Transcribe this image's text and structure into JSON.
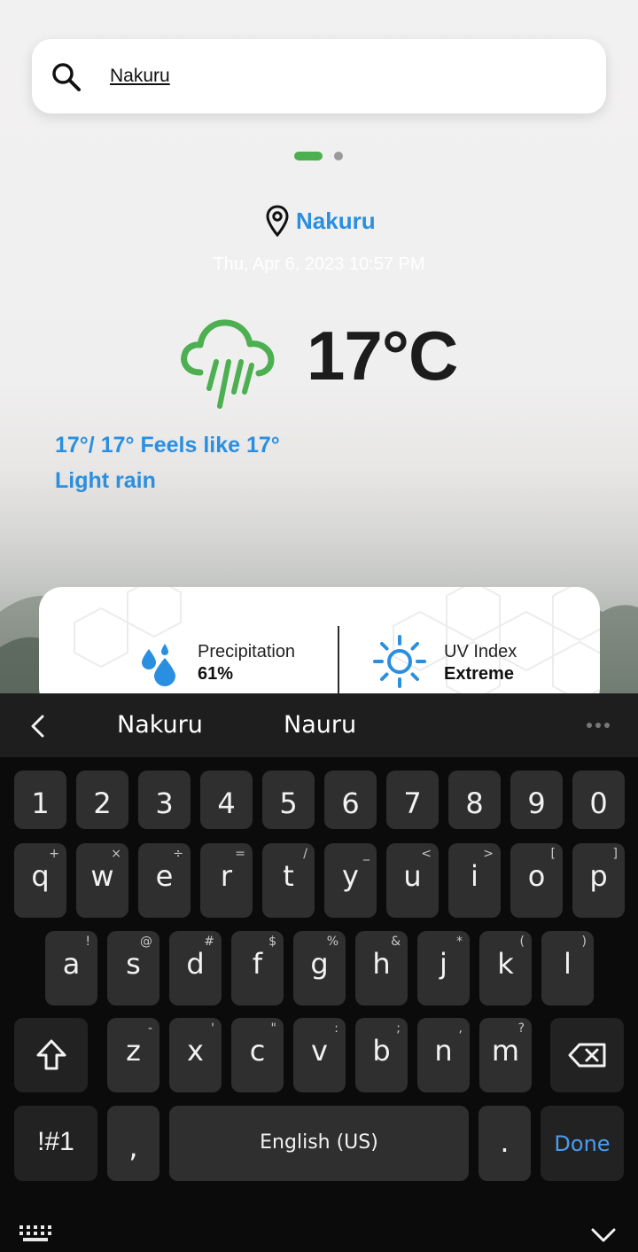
{
  "search": {
    "value": "Nakuru",
    "icon": "search-icon"
  },
  "location": {
    "name": "Nakuru",
    "icon": "location-pin-icon"
  },
  "datetime": "Thu, Apr 6, 2023 10:57 PM",
  "weather": {
    "icon": "rain-cloud-icon",
    "temperature": "17°C",
    "range": "17°/ 17° Feels like 17°",
    "condition": "Light rain"
  },
  "metrics": [
    {
      "label": "Precipitation",
      "value": "61%",
      "icon": "water-drops-icon"
    },
    {
      "label": "UV Index",
      "value": "Extreme",
      "icon": "sun-icon"
    }
  ],
  "colors": {
    "accent": "#2a8fe0",
    "green": "#4caf50",
    "keyboard_bg": "#0b0b0b",
    "key_bg": "#2f2f2f",
    "done": "#4b9cf0"
  },
  "keyboard": {
    "suggestions": [
      "Nakuru",
      "Nauru"
    ],
    "numbers": [
      "1",
      "2",
      "3",
      "4",
      "5",
      "6",
      "7",
      "8",
      "9",
      "0"
    ],
    "row1": [
      {
        "k": "q",
        "a": "+"
      },
      {
        "k": "w",
        "a": "×"
      },
      {
        "k": "e",
        "a": "÷"
      },
      {
        "k": "r",
        "a": "="
      },
      {
        "k": "t",
        "a": "/"
      },
      {
        "k": "y",
        "a": "_"
      },
      {
        "k": "u",
        "a": "<"
      },
      {
        "k": "i",
        "a": ">"
      },
      {
        "k": "o",
        "a": "["
      },
      {
        "k": "p",
        "a": "]"
      }
    ],
    "row2": [
      {
        "k": "a",
        "a": "!"
      },
      {
        "k": "s",
        "a": "@"
      },
      {
        "k": "d",
        "a": "#"
      },
      {
        "k": "f",
        "a": "$"
      },
      {
        "k": "g",
        "a": "%"
      },
      {
        "k": "h",
        "a": "&"
      },
      {
        "k": "j",
        "a": "*"
      },
      {
        "k": "k",
        "a": "("
      },
      {
        "k": "l",
        "a": ")"
      }
    ],
    "row3": [
      {
        "k": "z",
        "a": "-"
      },
      {
        "k": "x",
        "a": "'"
      },
      {
        "k": "c",
        "a": "\""
      },
      {
        "k": "v",
        "a": ":"
      },
      {
        "k": "b",
        "a": ";"
      },
      {
        "k": "n",
        "a": ","
      },
      {
        "k": "m",
        "a": "?"
      }
    ],
    "symbols_label": "!#1",
    "comma": ",",
    "space_label": "English (US)",
    "period": ".",
    "done_label": "Done"
  }
}
